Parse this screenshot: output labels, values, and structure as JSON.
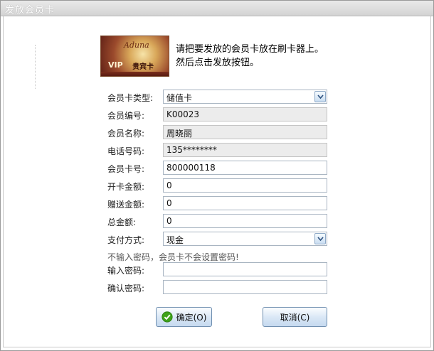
{
  "window": {
    "title": "发放会员卡"
  },
  "card_image": {
    "script_text": "Aduna",
    "vip_text": "VIP",
    "label_text": "贵宾卡"
  },
  "instruction": {
    "line1": "请把要发放的会员卡放在刷卡器上。",
    "line2": "然后点击发放按钮。"
  },
  "form": {
    "card_type": {
      "label": "会员卡类型:",
      "value": "储值卡"
    },
    "member_id": {
      "label": "会员编号:",
      "value": "K00023"
    },
    "member_name": {
      "label": "会员名称:",
      "value": "周晓丽"
    },
    "phone": {
      "label": "电话号码:",
      "value": "135********"
    },
    "card_number": {
      "label": "会员卡号:",
      "value": "800000118"
    },
    "opening_amount": {
      "label": "开卡金额:",
      "value": "0"
    },
    "bonus_amount": {
      "label": "赠送金额:",
      "value": "0"
    },
    "total_amount": {
      "label": "总金额:",
      "value": "0"
    },
    "payment_method": {
      "label": "支付方式:",
      "value": "现金"
    },
    "password_hint": "不输入密码，会员卡不会设置密码!",
    "password": {
      "label": "输入密码:",
      "value": ""
    },
    "confirm_password": {
      "label": "确认密码:",
      "value": ""
    }
  },
  "buttons": {
    "ok_label": "确定(O)",
    "cancel_label": "取消(C)"
  },
  "colors": {
    "ok_icon_green": "#3ea21a",
    "field_readonly_bg": "#ececec"
  },
  "icons": {
    "ok": "check-circle-icon",
    "dropdown": "chevron-down-icon"
  }
}
